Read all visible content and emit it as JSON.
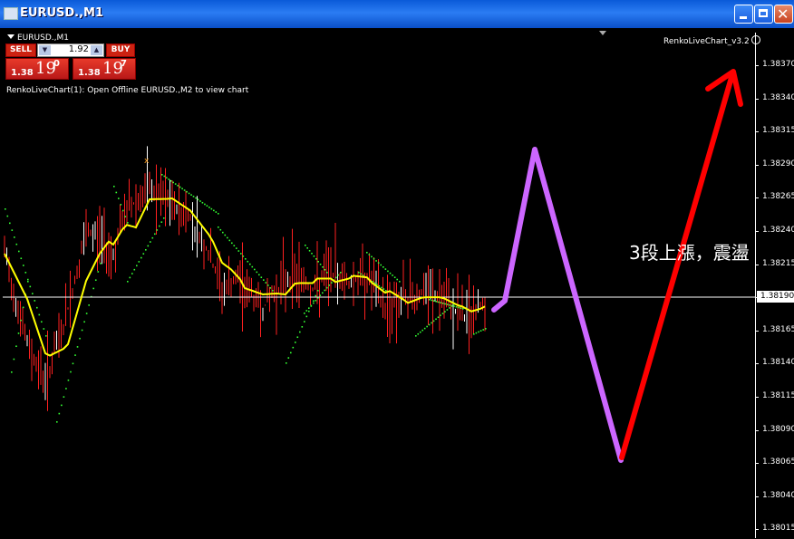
{
  "window": {
    "title": "EURUSD.,M1"
  },
  "chart": {
    "symbol_label": "EURUSD.,M1",
    "indicator_label": "RenkoLiveChart_v3.2",
    "message": "RenkoLiveChart(1): Open Offline EURUSD.,M2 to view chart",
    "current_price": "1.38190",
    "annotation": "3段上漲，震盪",
    "marker": "x",
    "price_ticks": [
      "1.38370",
      "1.38340",
      "1.38315",
      "1.38290",
      "1.38265",
      "1.38240",
      "1.38215",
      "1.38190",
      "1.38165",
      "1.38140",
      "1.38115",
      "1.38090",
      "1.38065",
      "1.38040",
      "1.38015"
    ]
  },
  "trade_panel": {
    "sell_label": "SELL",
    "buy_label": "BUY",
    "lot_value": "1.92",
    "sell_quote": {
      "prefix": "1.38",
      "big": "19",
      "sup": "0"
    },
    "buy_quote": {
      "prefix": "1.38",
      "big": "19",
      "sup": "7"
    }
  },
  "colors": {
    "background": "#000000",
    "candle": "#ff2020",
    "ma": "#ffff00",
    "envelope": "#33ff33",
    "purple_path": "#cc66ff",
    "red_arrow": "#ff0000"
  }
}
